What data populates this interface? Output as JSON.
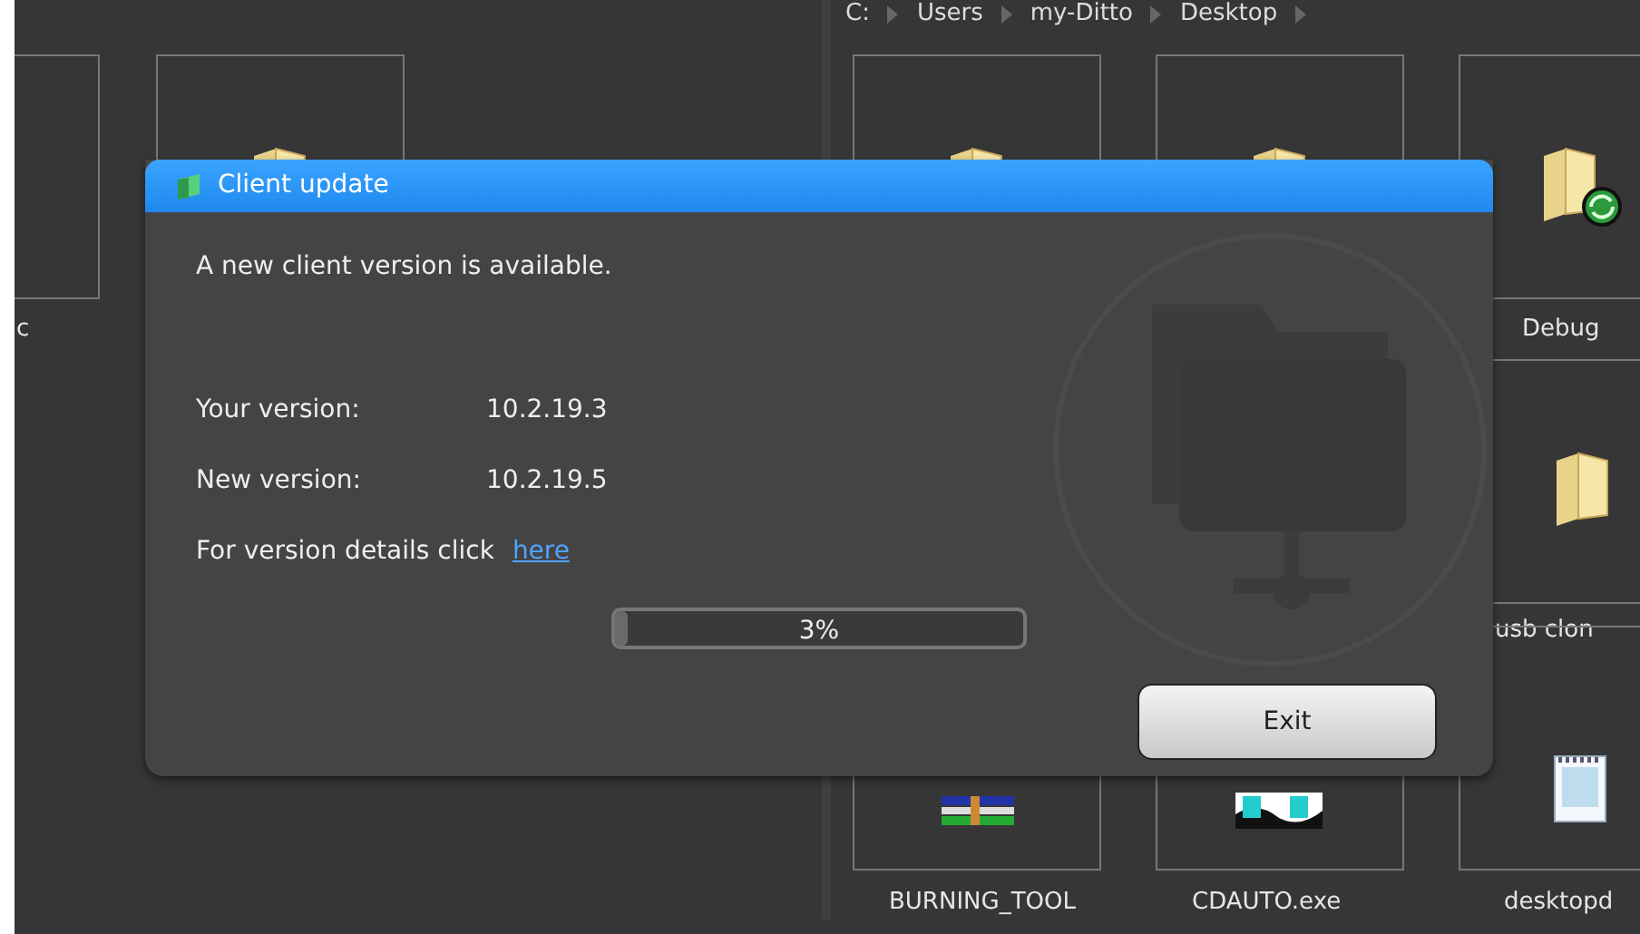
{
  "breadcrumb": [
    "C:",
    "Users",
    "my-Ditto",
    "Desktop"
  ],
  "left_panel": {
    "items": [
      {
        "kind": "blank",
        "label": "c"
      },
      {
        "kind": "folder"
      }
    ]
  },
  "right_panel": {
    "items": [
      {
        "kind": "folder"
      },
      {
        "kind": "folder"
      },
      {
        "kind": "folder-sync",
        "label": "Debug"
      },
      {
        "kind": "hidden"
      },
      {
        "kind": "hidden"
      },
      {
        "kind": "folder",
        "label": "usb clon"
      },
      {
        "kind": "archive",
        "label": "BURNING_TOOL"
      },
      {
        "kind": "exe",
        "label": "CDAUTO.exe"
      },
      {
        "kind": "notepad",
        "label": "desktopd"
      }
    ]
  },
  "dialog": {
    "title": "Client update",
    "message": "A new client version is available.",
    "rows": [
      {
        "label": "Your version:",
        "value": "10.2.19.3"
      },
      {
        "label": "New version:",
        "value": "10.2.19.5"
      }
    ],
    "details_text": "For version details click",
    "details_link": "here",
    "progress": {
      "level": 0.03,
      "reading": "3%"
    },
    "button": "Exit"
  }
}
